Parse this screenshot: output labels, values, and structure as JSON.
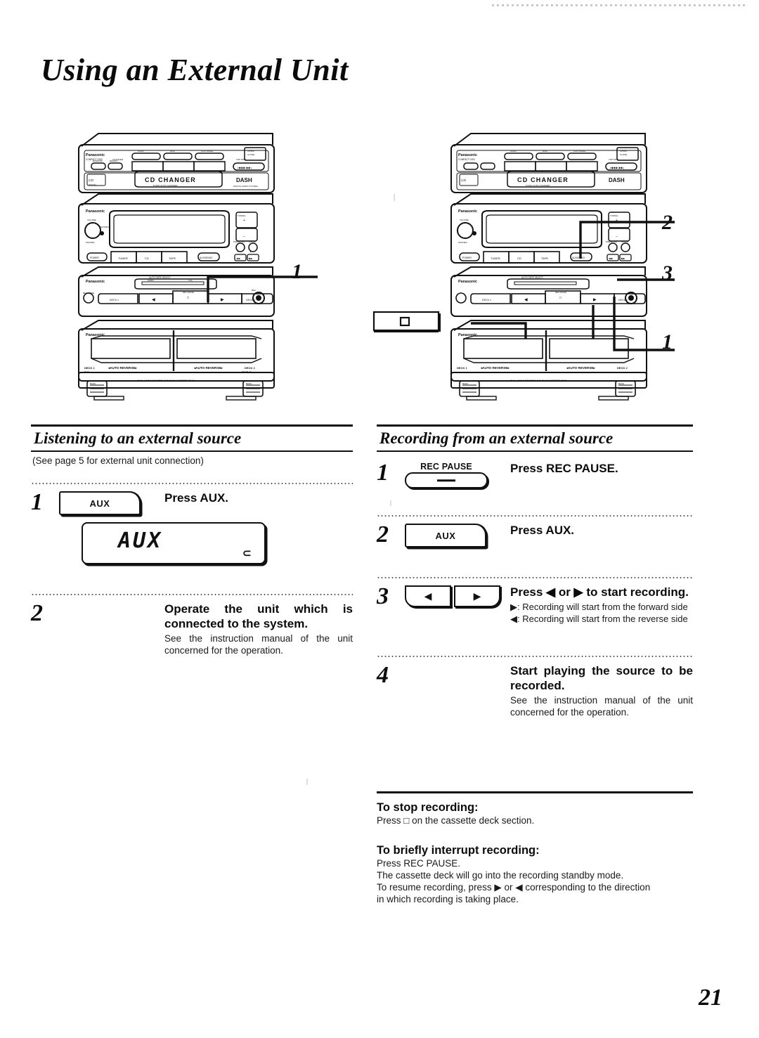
{
  "document": {
    "title": "Using an External Unit",
    "page_number": "21"
  },
  "illustrations": {
    "left": {
      "name": "stereo-system-front-view-listening",
      "brand_label": "Panasonic",
      "cd_changer_label": "CD CHANGER",
      "dash_label": "DASH",
      "deck_left_label": "DECK 1",
      "deck_right_label": "DECK 2",
      "auto_reverse_left": "AUTO REVERSE",
      "auto_reverse_right": "AUTO REVERSE",
      "callouts": [
        {
          "number": "1",
          "target": "aux-button"
        }
      ]
    },
    "right": {
      "name": "stereo-system-front-view-recording",
      "brand_label": "Panasonic",
      "cd_changer_label": "CD CHANGER",
      "dash_label": "DASH",
      "deck_left_label": "DECK 1",
      "deck_right_label": "DECK 2",
      "auto_reverse_left": "AUTO REVERSE",
      "auto_reverse_right": "AUTO REVERSE",
      "detail_box_symbol": "□",
      "callouts": [
        {
          "number": "2",
          "target": "rec-pause-button"
        },
        {
          "number": "3",
          "target": "direction-buttons"
        },
        {
          "number": "1",
          "target": "stop-button"
        }
      ]
    }
  },
  "left_column": {
    "heading": "Listening to an external source",
    "subtitle": "(See page 5 for external unit connection)",
    "steps": [
      {
        "number": "1",
        "key_label": "AUX",
        "title": "Press AUX.",
        "display": {
          "text": "AUX",
          "indicator": "⊃"
        }
      },
      {
        "number": "2",
        "title": "Operate the unit which is connected to the system.",
        "description": "See the instruction manual of the unit concerned for the operation."
      }
    ]
  },
  "right_column": {
    "heading": "Recording from an external source",
    "steps": [
      {
        "number": "1",
        "key_caption": "REC PAUSE",
        "title": "Press REC PAUSE."
      },
      {
        "number": "2",
        "key_label": "AUX",
        "title": "Press AUX."
      },
      {
        "number": "3",
        "key_left": "◀",
        "key_right": "▶",
        "title": "Press ◀ or ▶ to start recording.",
        "notes": [
          "▶: Recording will start from the forward side",
          "◀: Recording will start from the reverse side"
        ]
      },
      {
        "number": "4",
        "title": "Start playing the source to be recorded.",
        "description": "See the instruction manual of the unit concerned for the operation."
      }
    ],
    "bottom_notes": [
      {
        "heading": "To stop recording:",
        "lines": [
          "Press □ on the cassette deck section."
        ]
      },
      {
        "heading": "To briefly interrupt recording:",
        "lines": [
          "Press REC PAUSE.",
          "The cassette deck will go into the recording standby mode.",
          "To resume recording, press ▶ or ◀ corresponding to the direction",
          "in which recording is taking place."
        ]
      }
    ]
  }
}
